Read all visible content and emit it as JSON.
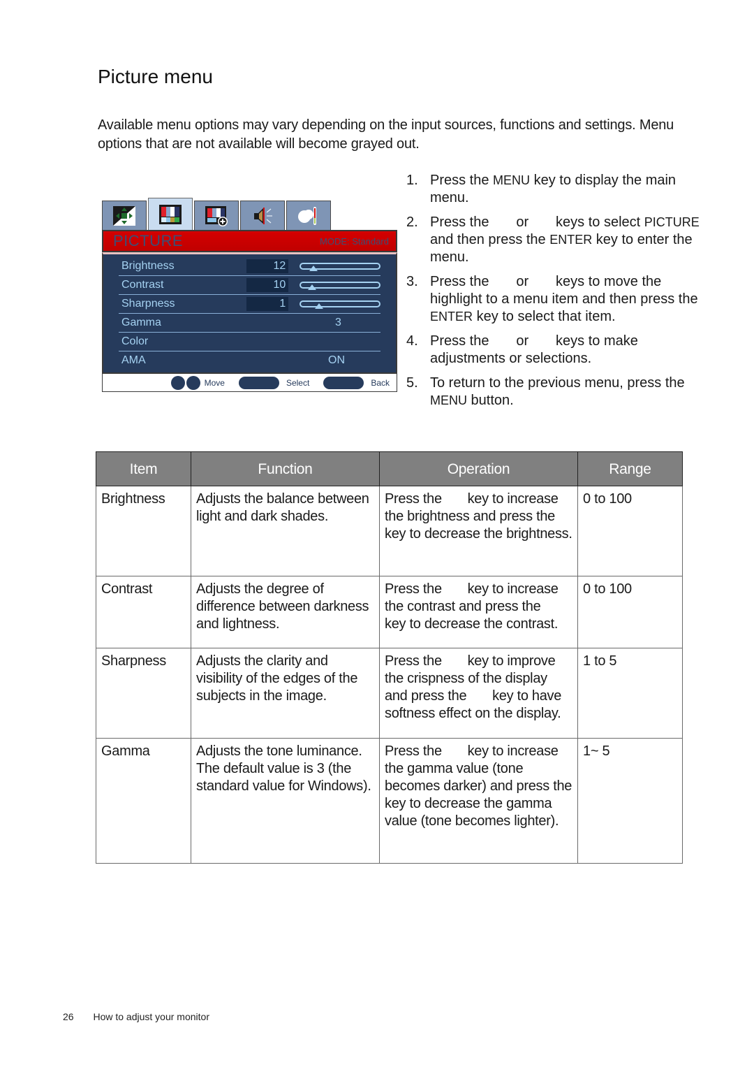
{
  "page": {
    "title": "Picture menu",
    "intro": "Available menu options may vary depending on the input sources, functions and settings. Menu options that are not available will become grayed out."
  },
  "osd": {
    "tabs": [
      {
        "icon": "display-position-icon",
        "active": false
      },
      {
        "icon": "picture-color-bars-icon",
        "active": true
      },
      {
        "icon": "picture-advanced-icon",
        "active": false
      },
      {
        "icon": "audio-speaker-icon",
        "active": false
      },
      {
        "icon": "system-settings-icon",
        "active": false
      }
    ],
    "header": {
      "name": "PICTURE",
      "mode": "MODE: Standard"
    },
    "rows": [
      {
        "label": "Brightness",
        "value": "12",
        "slider": 0.12
      },
      {
        "label": "Contrast",
        "value": "10",
        "slider": 0.1
      },
      {
        "label": "Sharpness",
        "value": "1",
        "slider": 0.2
      },
      {
        "label": "Gamma",
        "value": "3"
      },
      {
        "label": "Color",
        "value": ""
      },
      {
        "label": "AMA",
        "value": "ON"
      }
    ],
    "footer": {
      "move": "Move",
      "select": "Select",
      "back": "Back"
    }
  },
  "steps": [
    {
      "num": "1.",
      "text_a": "Press the ",
      "key": "MENU",
      "text_b": " key to display the main menu."
    },
    {
      "num": "2.",
      "text_a": "Press the       or       keys to select ",
      "key": "PICTURE",
      "text_b": " and then press the ",
      "key2": "ENTER",
      "text_c": " key to enter the menu."
    },
    {
      "num": "3.",
      "text_a": "Press the       or       keys to move the highlight to a menu item and then press the ",
      "key": "ENTER",
      "text_b": " key to select that item."
    },
    {
      "num": "4.",
      "text_a": "Press the       or       keys to make adjustments or selections."
    },
    {
      "num": "5.",
      "text_a": "To return to the previous menu, press the ",
      "key": "MENU",
      "text_b": " button."
    }
  ],
  "table": {
    "headers": [
      "Item",
      "Function",
      "Operation",
      "Range"
    ],
    "rows": [
      {
        "item": "Brightness",
        "function": "Adjusts the balance between light and dark shades.",
        "operation": "Press the       key to increase the brightness and press the       key to decrease the brightness.",
        "range": "0 to 100"
      },
      {
        "item": "Contrast",
        "function": "Adjusts the degree of difference between darkness and lightness.",
        "operation": "Press the       key to increase the contrast and press the       key to decrease the contrast.",
        "range": "0 to 100"
      },
      {
        "item": "Sharpness",
        "function": "Adjusts the clarity and visibility of the edges of the subjects in the image.",
        "operation": "Press the       key to improve the crispness of the display and press the       key to have softness effect on the display.",
        "range": "1 to 5"
      },
      {
        "item": "Gamma",
        "function": "Adjusts the tone luminance. The default value is 3 (the standard value for Windows).",
        "operation": "Press the       key to increase the gamma value (tone becomes darker) and press the       key to decrease the gamma value (tone becomes lighter).",
        "range": "1~ 5"
      }
    ]
  },
  "footer": {
    "page_number": "26",
    "section": "How to adjust your monitor"
  }
}
